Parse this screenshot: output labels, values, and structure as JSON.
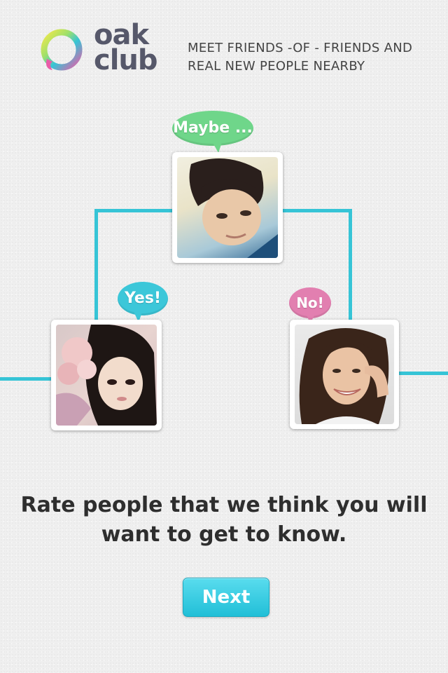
{
  "logo": {
    "line1": "oak",
    "line2": "club"
  },
  "tagline": {
    "line1": "MEET FRIENDS -OF - FRIENDS AND",
    "line2": "REAL NEW PEOPLE NEARBY"
  },
  "bubbles": {
    "maybe": {
      "text": "Maybe ...",
      "color": "#6fd68a"
    },
    "yes": {
      "text": "Yes!",
      "color": "#3cc7d9"
    },
    "no": {
      "text": "No!",
      "color": "#e27fb0"
    }
  },
  "headline": {
    "line1": "Rate people that we think you will",
    "line2": "want to get to know."
  },
  "next_button": {
    "label": "Next"
  },
  "colors": {
    "accent": "#36c4d6",
    "button": "#2ac6dc"
  }
}
